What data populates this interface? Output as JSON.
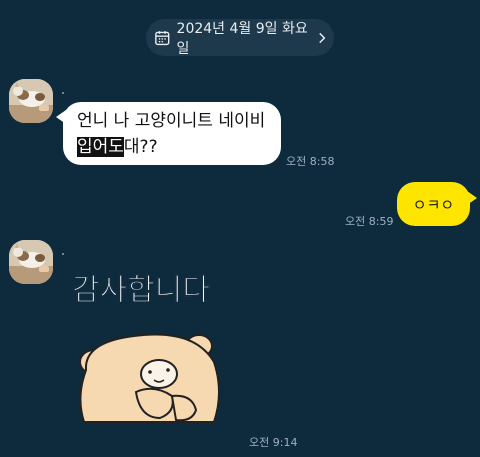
{
  "date_header": {
    "label": "2024년 4월 9일 화요일"
  },
  "messages": [
    {
      "side": "in",
      "text_plain": "언니 나 고양이니트 네이비",
      "text_hl": "입어도",
      "text_tail": "대??",
      "time": "오전 8:58"
    },
    {
      "side": "out",
      "text": "ㅇㅋㅇ",
      "time": "오전 8:59"
    },
    {
      "side": "in",
      "sticker_text": "감사합니다",
      "time": "오전 9:14"
    }
  ],
  "colors": {
    "background": "#0e2a3d",
    "outgoing_bubble": "#fde500",
    "incoming_bubble": "#ffffff"
  },
  "icons": [
    "calendar-icon",
    "chevron-right-icon"
  ]
}
